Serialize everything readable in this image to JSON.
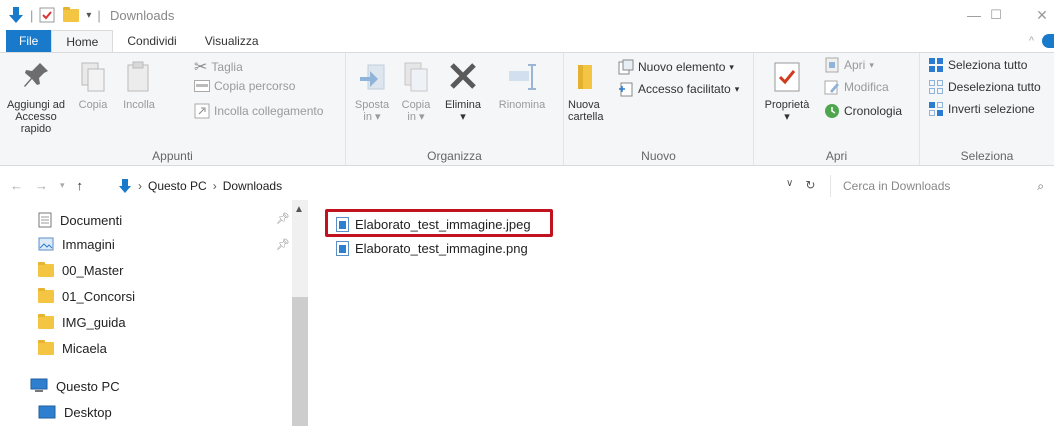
{
  "window": {
    "title": "Downloads"
  },
  "tabs": {
    "file": "File",
    "home": "Home",
    "share": "Condividi",
    "view": "Visualizza"
  },
  "ribbon": {
    "clipboard": {
      "label": "Appunti",
      "pin_line1": "Aggiungi ad",
      "pin_line2": "Accesso rapido",
      "copy": "Copia",
      "paste": "Incolla",
      "cut": "Taglia",
      "copy_path": "Copia percorso",
      "paste_shortcut": "Incolla collegamento"
    },
    "organize": {
      "label": "Organizza",
      "move_line1": "Sposta",
      "move_line2": "in",
      "copyto_line1": "Copia",
      "copyto_line2": "in",
      "delete": "Elimina",
      "rename": "Rinomina"
    },
    "new": {
      "label": "Nuovo",
      "folder_line1": "Nuova",
      "folder_line2": "cartella",
      "new_item": "Nuovo elemento",
      "easy_access": "Accesso facilitato"
    },
    "open": {
      "label": "Apri",
      "properties": "Proprietà",
      "open": "Apri",
      "edit": "Modifica",
      "history": "Cronologia"
    },
    "select": {
      "label": "Seleziona",
      "select_all": "Seleziona tutto",
      "select_none": "Deseleziona tutto",
      "invert": "Inverti selezione"
    }
  },
  "address": {
    "crumb1": "Questo PC",
    "crumb2": "Downloads",
    "search_placeholder": "Cerca in Downloads"
  },
  "nav": {
    "items": [
      {
        "label": "Documenti"
      },
      {
        "label": "Immagini"
      },
      {
        "label": "00_Master"
      },
      {
        "label": "01_Concorsi"
      },
      {
        "label": "IMG_guida"
      },
      {
        "label": "Micaela"
      },
      {
        "label": "Questo PC"
      },
      {
        "label": "Desktop"
      }
    ]
  },
  "files": [
    {
      "name": "Elaborato_test_immagine.jpeg"
    },
    {
      "name": "Elaborato_test_immagine.png"
    }
  ],
  "colors": {
    "accent": "#1979ca",
    "highlight": "#c3121f",
    "folder": "#f4c542"
  }
}
